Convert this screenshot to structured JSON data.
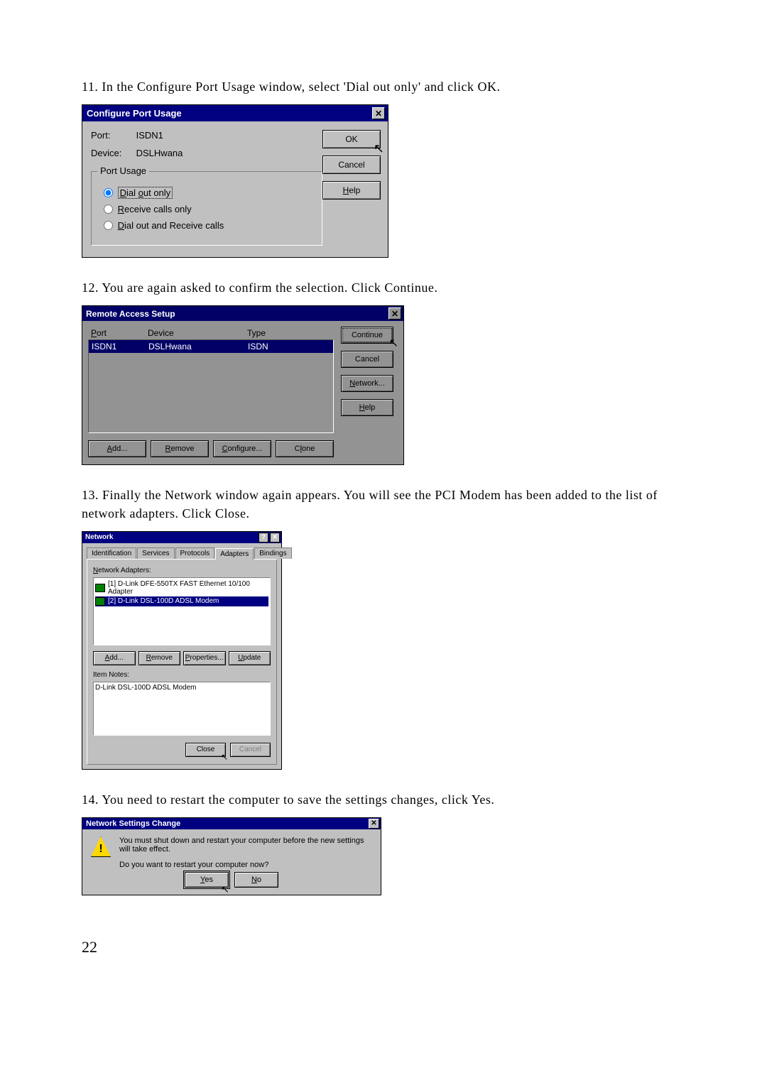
{
  "steps": {
    "s11": "11. In the Configure Port Usage window, select 'Dial out only' and click OK.",
    "s12": "12. You are again asked to confirm the selection. Click Continue.",
    "s13": "13. Finally the Network window again appears. You will see the PCI Modem has been added to the list of network adapters. Click Close.",
    "s14": "14. You need to restart the computer to save the settings changes, click Yes."
  },
  "page_number": "22",
  "dlg1": {
    "title": "Configure Port Usage",
    "port_label": "Port:",
    "port_value": "ISDN1",
    "device_label": "Device:",
    "device_value": "DSLHwana",
    "group_label": "Port Usage",
    "opt_dialout": "Dial out only",
    "opt_receive": "Receive calls only",
    "opt_both": "Dial out and Receive calls",
    "btn_ok": "OK",
    "btn_cancel": "Cancel",
    "btn_help": "Help"
  },
  "dlg2": {
    "title": "Remote Access Setup",
    "col_port": "Port",
    "col_device": "Device",
    "col_type": "Type",
    "row_port": "ISDN1",
    "row_device": "DSLHwana",
    "row_type": "ISDN",
    "btn_add": "Add...",
    "btn_remove": "Remove",
    "btn_configure": "Configure...",
    "btn_clone": "Clone",
    "btn_continue": "Continue",
    "btn_cancel": "Cancel",
    "btn_network": "Network...",
    "btn_help": "Help"
  },
  "dlg3": {
    "title": "Network",
    "tabs": {
      "identification": "Identification",
      "services": "Services",
      "protocols": "Protocols",
      "adapters": "Adapters",
      "bindings": "Bindings"
    },
    "adapters_label": "Network Adapters:",
    "adapter1": "[1] D-Link DFE-550TX FAST Ethernet 10/100 Adapter",
    "adapter2": "[2] D-Link DSL-100D ADSL Modem",
    "btn_add": "Add...",
    "btn_remove": "Remove",
    "btn_properties": "Properties...",
    "btn_update": "Update",
    "notes_label": "Item Notes:",
    "notes_text": "D-Link DSL-100D ADSL Modem",
    "btn_close": "Close",
    "btn_cancel": "Cancel"
  },
  "dlg4": {
    "title": "Network Settings Change",
    "line1": "You must shut down and restart your computer before the new settings will take effect.",
    "line2": "Do you want to restart your computer now?",
    "btn_yes": "Yes",
    "btn_no": "No"
  }
}
